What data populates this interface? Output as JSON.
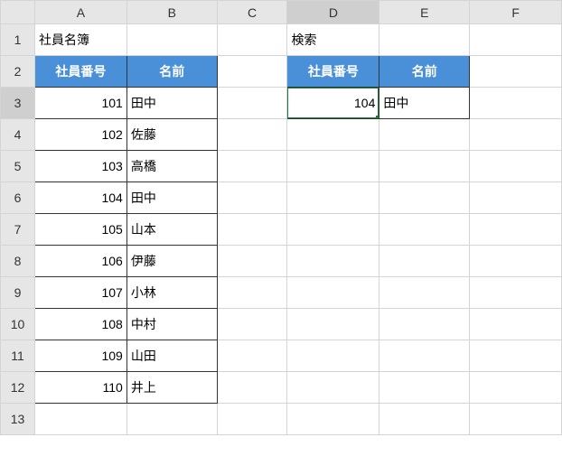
{
  "columns": [
    "A",
    "B",
    "C",
    "D",
    "E",
    "F"
  ],
  "rows": [
    "1",
    "2",
    "3",
    "4",
    "5",
    "6",
    "7",
    "8",
    "9",
    "10",
    "11",
    "12",
    "13"
  ],
  "titles": {
    "list": "社員名簿",
    "search": "検索"
  },
  "headers": {
    "emp_no": "社員番号",
    "name": "名前"
  },
  "list": [
    {
      "no": "101",
      "name": "田中"
    },
    {
      "no": "102",
      "name": "佐藤"
    },
    {
      "no": "103",
      "name": "高橋"
    },
    {
      "no": "104",
      "name": "田中"
    },
    {
      "no": "105",
      "name": "山本"
    },
    {
      "no": "106",
      "name": "伊藤"
    },
    {
      "no": "107",
      "name": "小林"
    },
    {
      "no": "108",
      "name": "中村"
    },
    {
      "no": "109",
      "name": "山田"
    },
    {
      "no": "110",
      "name": "井上"
    }
  ],
  "search": {
    "no": "104",
    "result": "田中"
  },
  "selected_cell": "D3"
}
